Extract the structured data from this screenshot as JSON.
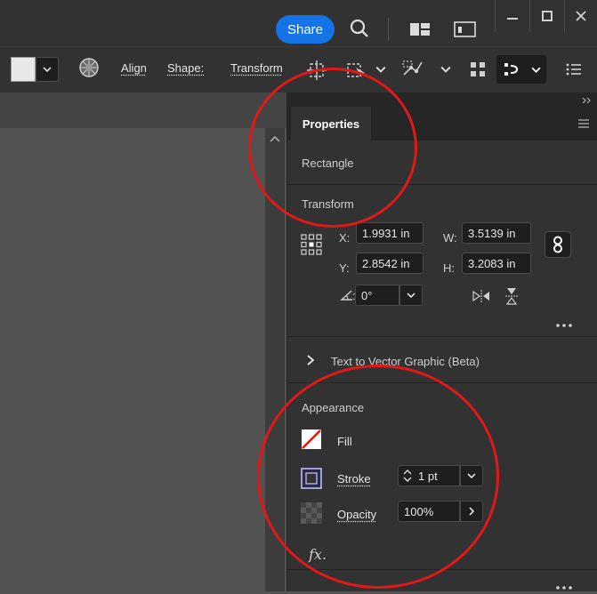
{
  "titlebar": {
    "share_label": "Share",
    "icons": [
      "search-icon",
      "panel-layout-icon",
      "window-layout-icon",
      "minimize-icon",
      "maximize-icon",
      "close-icon"
    ]
  },
  "toolbar": {
    "align_label": "Align",
    "shape_label": "Shape:",
    "transform_label": "Transform",
    "fill_swatch_color": "#e8e8e8"
  },
  "panel": {
    "tab_label": "Properties",
    "object_type": "Rectangle",
    "transform": {
      "title": "Transform",
      "x_label": "X:",
      "x_value": "1.9931 in",
      "y_label": "Y:",
      "y_value": "2.8542 in",
      "w_label": "W:",
      "w_value": "3.5139 in",
      "h_label": "H:",
      "h_value": "3.2083 in",
      "rotate_value": "0°"
    },
    "text_to_vector_label": "Text to Vector Graphic (Beta)",
    "appearance": {
      "title": "Appearance",
      "fill_label": "Fill",
      "stroke_label": "Stroke",
      "stroke_value": "1 pt",
      "opacity_label": "Opacity",
      "opacity_value": "100%",
      "fx_label": "fx."
    }
  },
  "colors": {
    "accent": "#1473e6",
    "annotation": "#e01818"
  }
}
